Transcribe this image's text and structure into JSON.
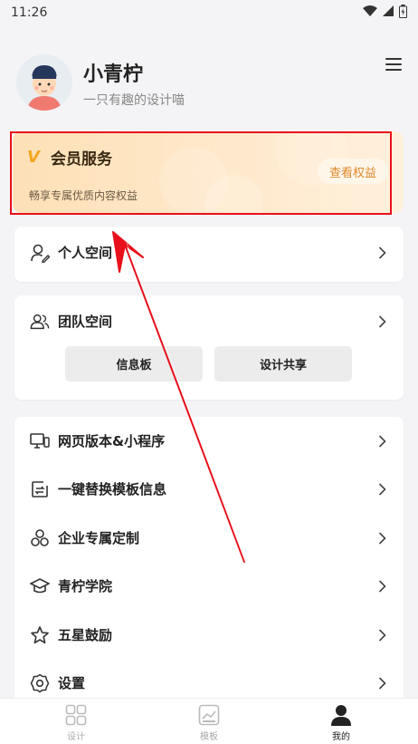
{
  "status_bar": {
    "time": "11:26"
  },
  "profile": {
    "name": "小青柠",
    "bio": "一只有趣的设计喵"
  },
  "vip": {
    "mark": "V",
    "title": "会员服务",
    "description": "畅享专属优质内容权益",
    "button_label": "查看权益"
  },
  "personal": {
    "label": "个人空间"
  },
  "team": {
    "label": "团队空间",
    "buttons": [
      "信息板",
      "设计共享"
    ]
  },
  "menu_items": [
    {
      "label": "网页版本&小程序",
      "icon": "monitor-icon"
    },
    {
      "label": "一键替换模板信息",
      "icon": "replace-icon"
    },
    {
      "label": "企业专属定制",
      "icon": "enterprise-icon"
    },
    {
      "label": "青柠学院",
      "icon": "graduation-cap-icon"
    },
    {
      "label": "五星鼓励",
      "icon": "star-icon"
    },
    {
      "label": "设置",
      "icon": "settings-gear-icon"
    }
  ],
  "bottom_nav": [
    {
      "label": "设计",
      "icon": "design-grid-icon",
      "active": false
    },
    {
      "label": "模板",
      "icon": "template-icon",
      "active": false
    },
    {
      "label": "我的",
      "icon": "profile-user-icon",
      "active": true
    }
  ],
  "colors": {
    "accent_red": "#e8101b",
    "vip_orange": "#e08a2c",
    "vip_bg": "#fde0b6"
  }
}
